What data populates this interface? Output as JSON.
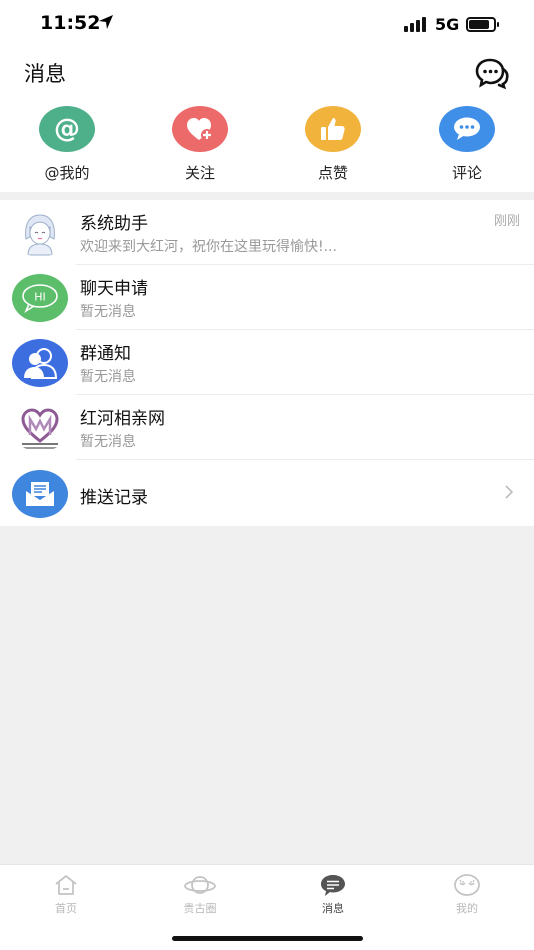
{
  "status_bar": {
    "time": "11:52",
    "network": "5G"
  },
  "header": {
    "title": "消息"
  },
  "quick_actions": [
    {
      "label": "@我的",
      "icon": "at-icon",
      "color": "#4db08a"
    },
    {
      "label": "关注",
      "icon": "heart-plus-icon",
      "color": "#ec6a6a"
    },
    {
      "label": "点赞",
      "icon": "thumbs-up-icon",
      "color": "#f2b33d"
    },
    {
      "label": "评论",
      "icon": "comment-icon",
      "color": "#3f8fe8"
    }
  ],
  "messages": [
    {
      "name": "系统助手",
      "preview": "欢迎来到大红河，祝你在这里玩得愉快!...",
      "time": "刚刚"
    },
    {
      "name": "聊天申请",
      "preview": "暂无消息",
      "avatar_text": "HI"
    },
    {
      "name": "群通知",
      "preview": "暂无消息"
    },
    {
      "name": "红河相亲网",
      "preview": "暂无消息"
    },
    {
      "name": "推送记录"
    }
  ],
  "tabs": [
    {
      "label": "首页",
      "icon": "home-icon"
    },
    {
      "label": "贵古圈",
      "icon": "planet-icon"
    },
    {
      "label": "消息",
      "icon": "message-icon",
      "active": true
    },
    {
      "label": "我的",
      "icon": "face-icon"
    }
  ]
}
